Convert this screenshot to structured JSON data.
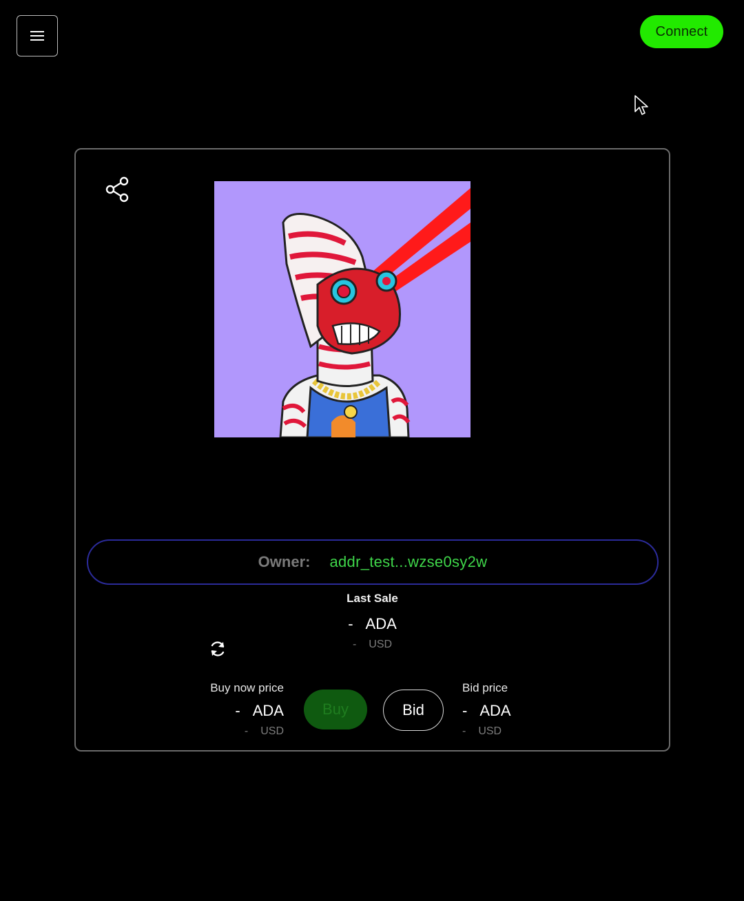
{
  "header": {
    "connect_label": "Connect"
  },
  "owner": {
    "label": "Owner:",
    "address": "addr_test...wzse0sy2w"
  },
  "last_sale": {
    "title": "Last Sale",
    "ada_value": "-",
    "ada_unit": "ADA",
    "usd_value": "-",
    "usd_unit": "USD"
  },
  "buy_now": {
    "label": "Buy now price",
    "ada_value": "-",
    "ada_unit": "ADA",
    "usd_value": "-",
    "usd_unit": "USD",
    "button_label": "Buy",
    "button_disabled": true
  },
  "bid": {
    "label": "Bid price",
    "ada_value": "-",
    "ada_unit": "ADA",
    "usd_value": "-",
    "usd_unit": "USD",
    "button_label": "Bid"
  },
  "colors": {
    "connect": "#22ea00",
    "owner_address": "#3fd64a",
    "owner_border": "#2b2b9a",
    "buy_disabled": "#0f5a10",
    "nft_background": "#b197fc"
  },
  "icons": [
    "menu-icon",
    "share-icon",
    "refresh-icon",
    "cursor-icon"
  ]
}
